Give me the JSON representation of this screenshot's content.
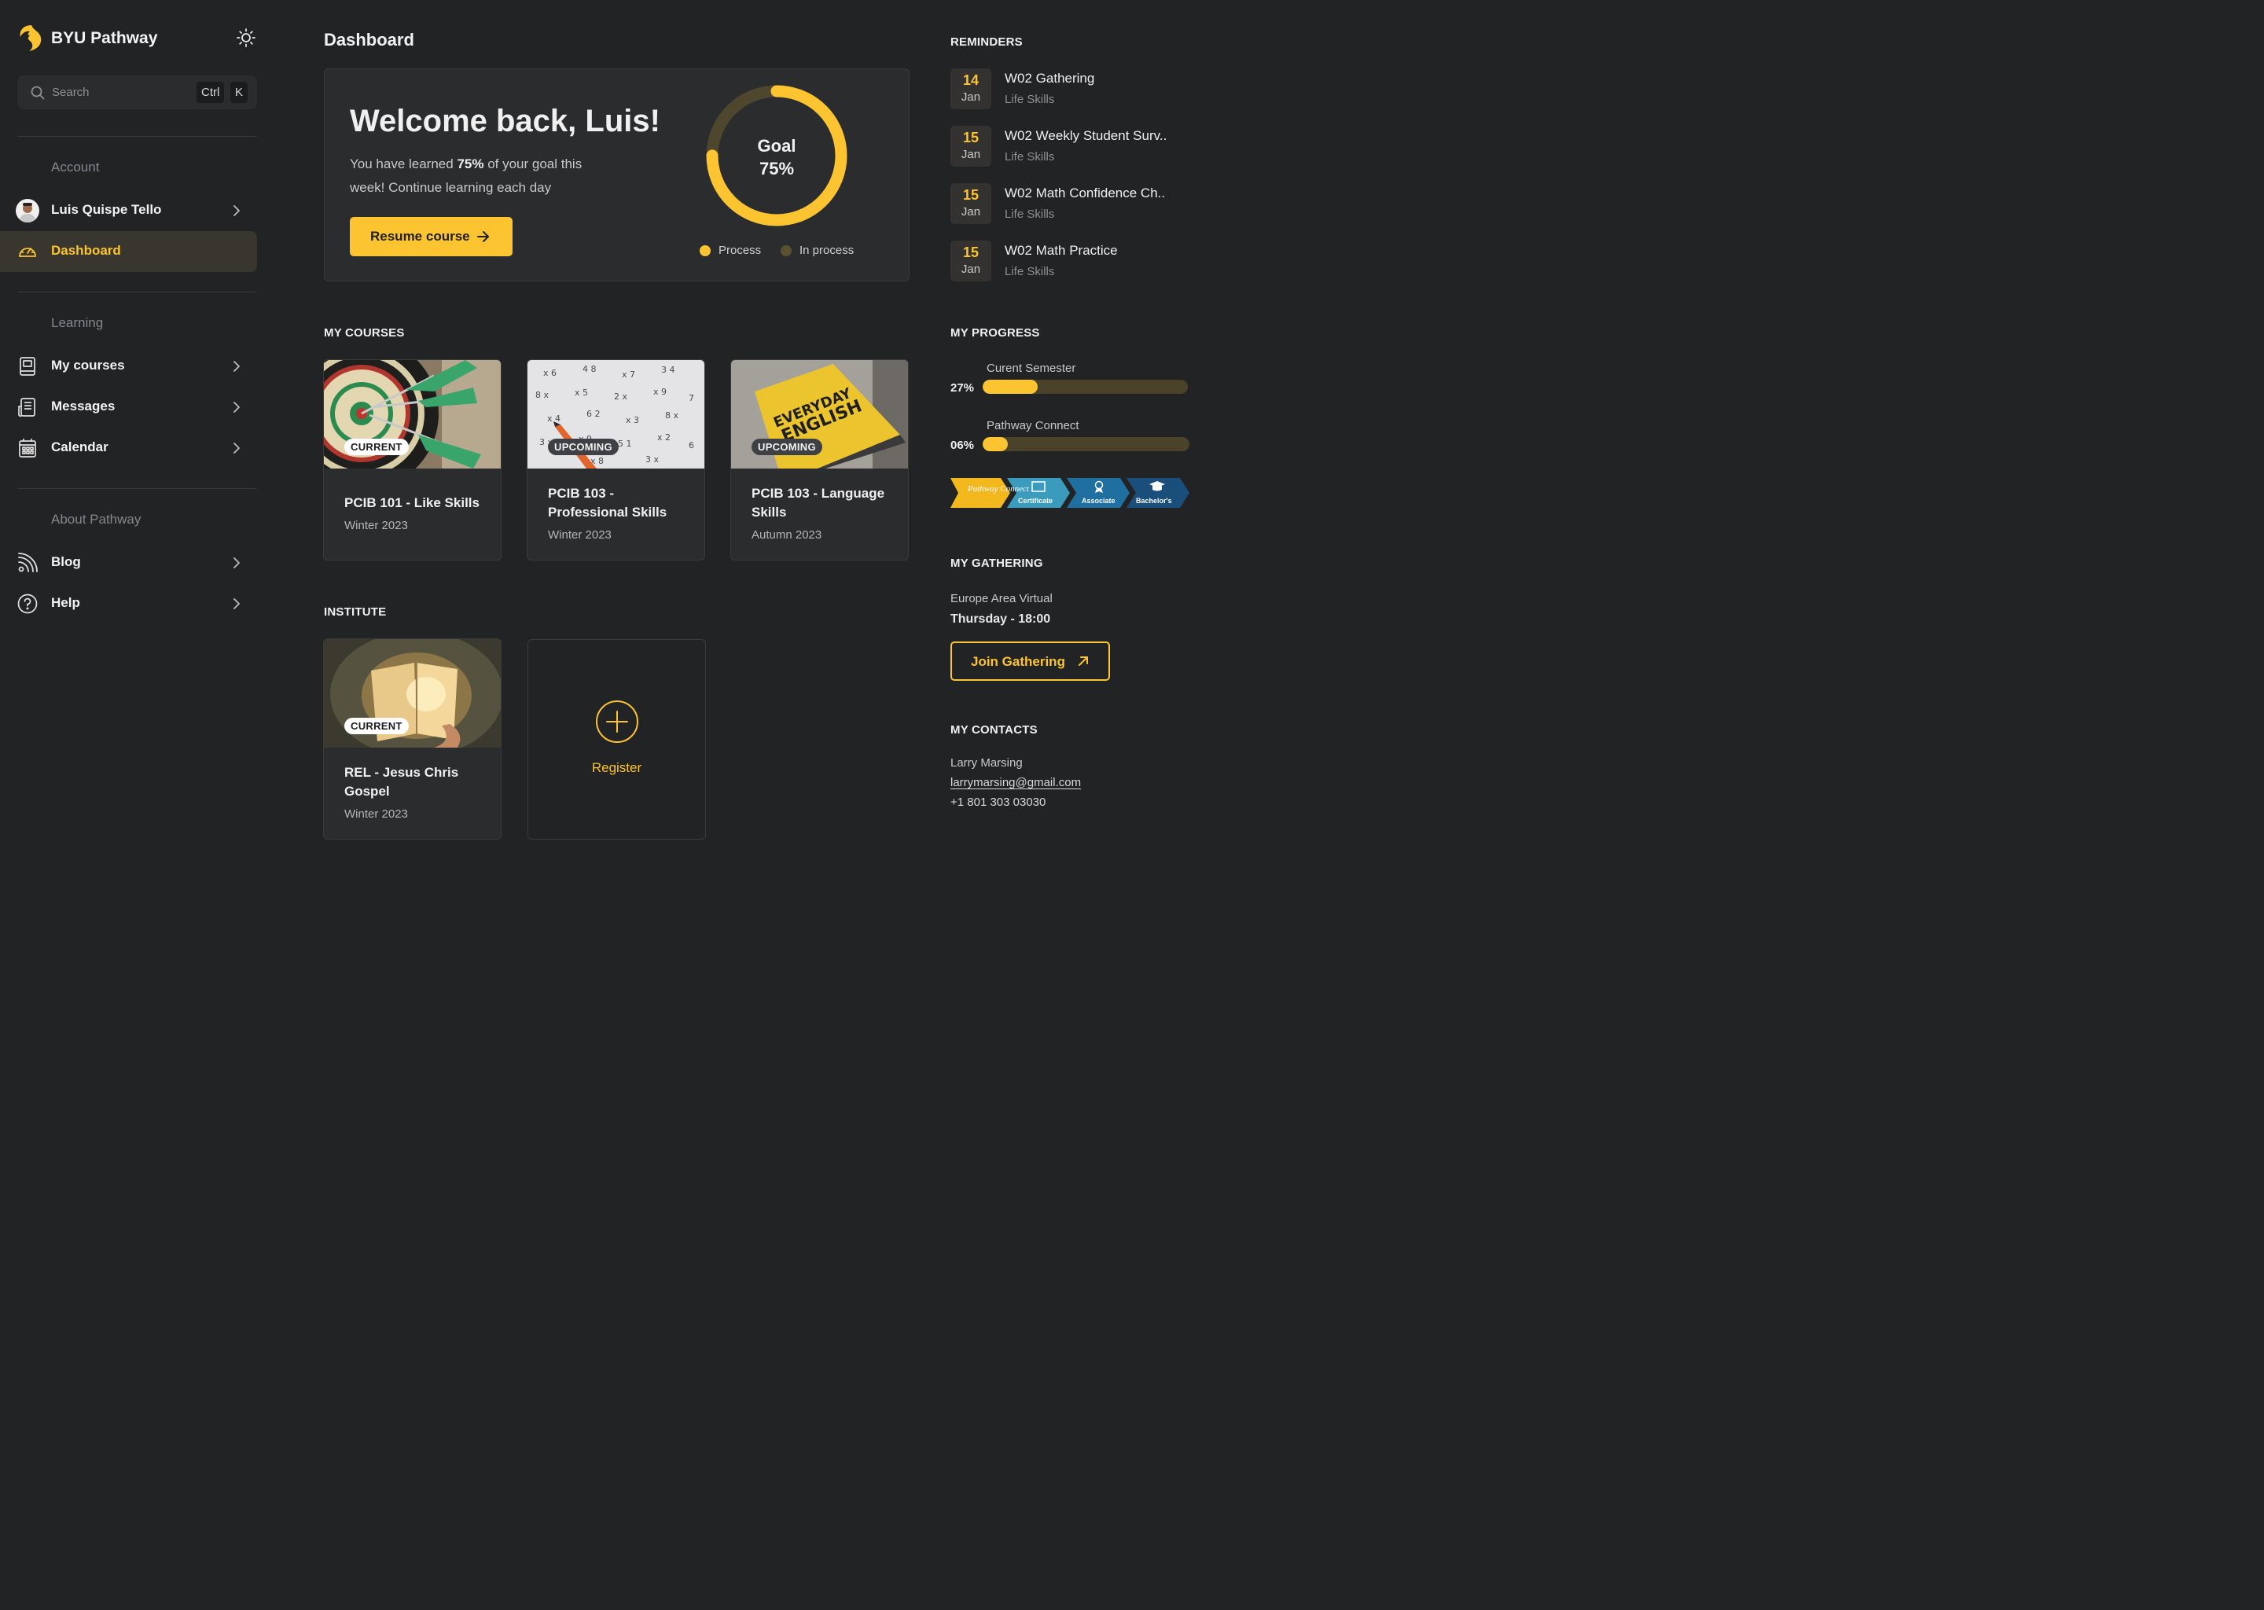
{
  "brand": {
    "name": "BYU Pathway"
  },
  "search": {
    "placeholder": "Search",
    "shortcut_ctrl": "Ctrl",
    "shortcut_key": "K"
  },
  "sidebar": {
    "account_label": "Account",
    "user_name": "Luis Quispe Tello",
    "dashboard_label": "Dashboard",
    "learning_label": "Learning",
    "learning_items": [
      "My courses",
      "Messages",
      "Calendar"
    ],
    "about_label": "About Pathway",
    "about_items": [
      "Blog",
      "Help"
    ]
  },
  "page": {
    "title": "Dashboard"
  },
  "welcome": {
    "heading": "Welcome back, Luis!",
    "desc_before": "You have learned ",
    "desc_pct": "75%",
    "desc_after": " of your goal this week! Continue learning each day",
    "resume_label": "Resume course",
    "goal_label": "Goal",
    "goal_value": "75%",
    "goal_fraction": 0.75,
    "legend_process": "Process",
    "legend_in_process": "In process"
  },
  "my_courses": {
    "heading": "MY COURSES",
    "items": [
      {
        "badge": "CURRENT",
        "title": "PCIB 101 - Like Skills",
        "term": "Winter 2023"
      },
      {
        "badge": "UPCOMING",
        "title": "PCIB 103 - Professional Skills",
        "term": "Winter 2023"
      },
      {
        "badge": "UPCOMING",
        "title": "PCIB 103 - Language Skills",
        "term": "Autumn 2023"
      }
    ]
  },
  "institute": {
    "heading": "INSTITUTE",
    "item": {
      "badge": "CURRENT",
      "title": "REL - Jesus Chris Gospel",
      "term": "Winter 2023"
    },
    "register_label": "Register"
  },
  "reminders": {
    "heading": "REMINDERS",
    "items": [
      {
        "day": "14",
        "month": "Jan",
        "title": "W02 Gathering",
        "subtitle": "Life Skills"
      },
      {
        "day": "15",
        "month": "Jan",
        "title": "W02 Weekly Student Surv..",
        "subtitle": "Life Skills"
      },
      {
        "day": "15",
        "month": "Jan",
        "title": "W02 Math Confidence Ch..",
        "subtitle": "Life Skills"
      },
      {
        "day": "15",
        "month": "Jan",
        "title": "W02 Math Practice",
        "subtitle": "Life Skills"
      }
    ]
  },
  "progress": {
    "heading": "MY PROGRESS",
    "items": [
      {
        "label": "Curent Semester",
        "pct_text": "27%",
        "fraction": 0.27
      },
      {
        "label": "Pathway Connect",
        "pct_text": "06%",
        "fraction": 0.06
      }
    ],
    "steps": [
      "Pathway Connect",
      "Certificate",
      "Associate",
      "Bachelor's"
    ]
  },
  "gathering": {
    "heading": "MY GATHERING",
    "area": "Europe Area Virtual",
    "time": "Thursday - 18:00",
    "join_label": "Join Gathering"
  },
  "contacts": {
    "heading": "MY CONTACTS",
    "name": "Larry Marsing",
    "email": "larrymarsing@gmail.com",
    "phone": "+1 801 303 03030"
  },
  "colors": {
    "accent": "#fbc430",
    "background": "#222325",
    "panel": "#2b2c2e",
    "track": "#4a4229"
  }
}
